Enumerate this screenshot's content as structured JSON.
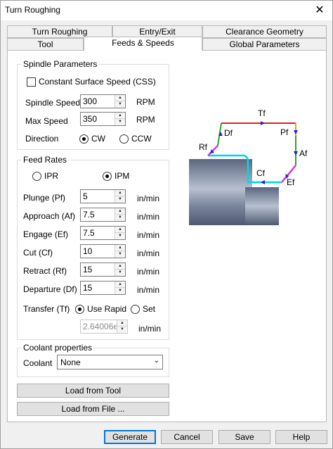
{
  "window": {
    "title": "Turn Roughing",
    "close_glyph": "✕"
  },
  "tabs_top": [
    "Turn Roughing",
    "Entry/Exit",
    "Clearance Geometry"
  ],
  "tabs_bottom": [
    "Tool",
    "Feeds & Speeds",
    "Global Parameters"
  ],
  "spindle": {
    "legend": "Spindle Parameters",
    "css_label": "Constant Surface Speed (CSS)",
    "speed_label": "Spindle Speed",
    "speed_value": "300",
    "speed_unit": "RPM",
    "max_label": "Max Speed",
    "max_value": "350",
    "max_unit": "RPM",
    "direction_label": "Direction",
    "cw": "CW",
    "ccw": "CCW"
  },
  "feeds": {
    "legend": "Feed Rates",
    "ipr": "IPR",
    "ipm": "IPM",
    "rows": [
      {
        "label": "Plunge (Pf)",
        "value": "5",
        "unit": "in/min"
      },
      {
        "label": "Approach (Af)",
        "value": "7.5",
        "unit": "in/min"
      },
      {
        "label": "Engage (Ef)",
        "value": "7.5",
        "unit": "in/min"
      },
      {
        "label": "Cut (Cf)",
        "value": "10",
        "unit": "in/min"
      },
      {
        "label": "Retract (Rf)",
        "value": "15",
        "unit": "in/min"
      },
      {
        "label": "Departure  (Df)",
        "value": "15",
        "unit": "in/min"
      }
    ],
    "transfer_label": "Transfer (Tf)",
    "use_rapid": "Use Rapid",
    "set": "Set",
    "transfer_value": "2.64006e",
    "transfer_unit": "in/min"
  },
  "coolant": {
    "legend": "Coolant properties",
    "label": "Coolant",
    "value": "None"
  },
  "buttons": {
    "load_tool": "Load from Tool",
    "load_file": "Load from File ...",
    "generate": "Generate",
    "cancel": "Cancel",
    "save": "Save",
    "help": "Help"
  },
  "diagram": {
    "tf": "Tf",
    "df": "Df",
    "rf": "Rf",
    "pf": "Pf",
    "af": "Af",
    "cf": "Cf",
    "ef": "Ef"
  }
}
